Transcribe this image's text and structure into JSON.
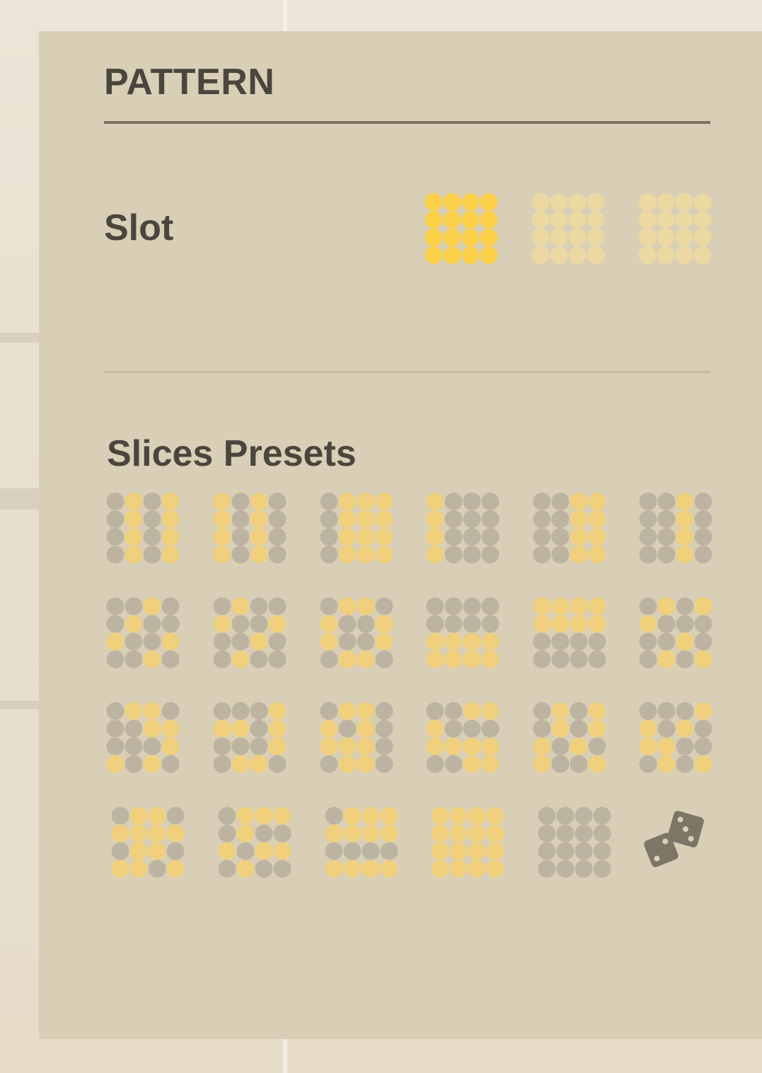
{
  "header": {
    "title": "PATTERN"
  },
  "slot": {
    "label": "Slot",
    "slots": [
      {
        "name": "slot-1",
        "state": "selected"
      },
      {
        "name": "slot-2",
        "state": "empty"
      },
      {
        "name": "slot-3",
        "state": "empty"
      }
    ]
  },
  "presets": {
    "label": "Slices Presets",
    "patterns": [
      [
        "0101",
        "0101",
        "0101",
        "0101"
      ],
      [
        "1010",
        "1010",
        "1010",
        "1010"
      ],
      [
        "0111",
        "0111",
        "0111",
        "0111"
      ],
      [
        "1000",
        "1000",
        "1000",
        "1000"
      ],
      [
        "0011",
        "0011",
        "0011",
        "0011"
      ],
      [
        "0010",
        "0010",
        "0010",
        "0010"
      ],
      [
        "0010",
        "0100",
        "1001",
        "0010"
      ],
      [
        "0100",
        "1001",
        "0010",
        "0100"
      ],
      [
        "0110",
        "1001",
        "1001",
        "0110"
      ],
      [
        "0000",
        "0000",
        "1111",
        "1111"
      ],
      [
        "1111",
        "1111",
        "0000",
        "0000"
      ],
      [
        "0101",
        "1000",
        "0010",
        "0101"
      ],
      [
        "0110",
        "0011",
        "0001",
        "1010"
      ],
      [
        "0001",
        "1101",
        "0001",
        "0110"
      ],
      [
        "0110",
        "1010",
        "1110",
        "0110"
      ],
      [
        "0011",
        "1000",
        "1111",
        "0011"
      ],
      [
        "0101",
        "0101",
        "1010",
        "1001"
      ],
      [
        "0001",
        "1010",
        "1100",
        "0101"
      ],
      [
        "0110",
        "1111",
        "0110",
        "1101"
      ],
      [
        "0111",
        "0100",
        "1011",
        "0100"
      ],
      [
        "0111",
        "1111",
        "0000",
        "1111"
      ],
      [
        "1111",
        "1111",
        "1111",
        "1111"
      ],
      [
        "0000",
        "0000",
        "0000",
        "0000"
      ]
    ],
    "randomize_icon": "dice-icon"
  },
  "colors": {
    "panel_bg": "#d8cfb6",
    "dot_on": "#f0d07c",
    "dot_off": "#bdb3a1",
    "slot_selected": "#fdd14a",
    "slot_empty": "#ecd9a2",
    "text": "#4a463e",
    "dice": "#7d7566"
  }
}
